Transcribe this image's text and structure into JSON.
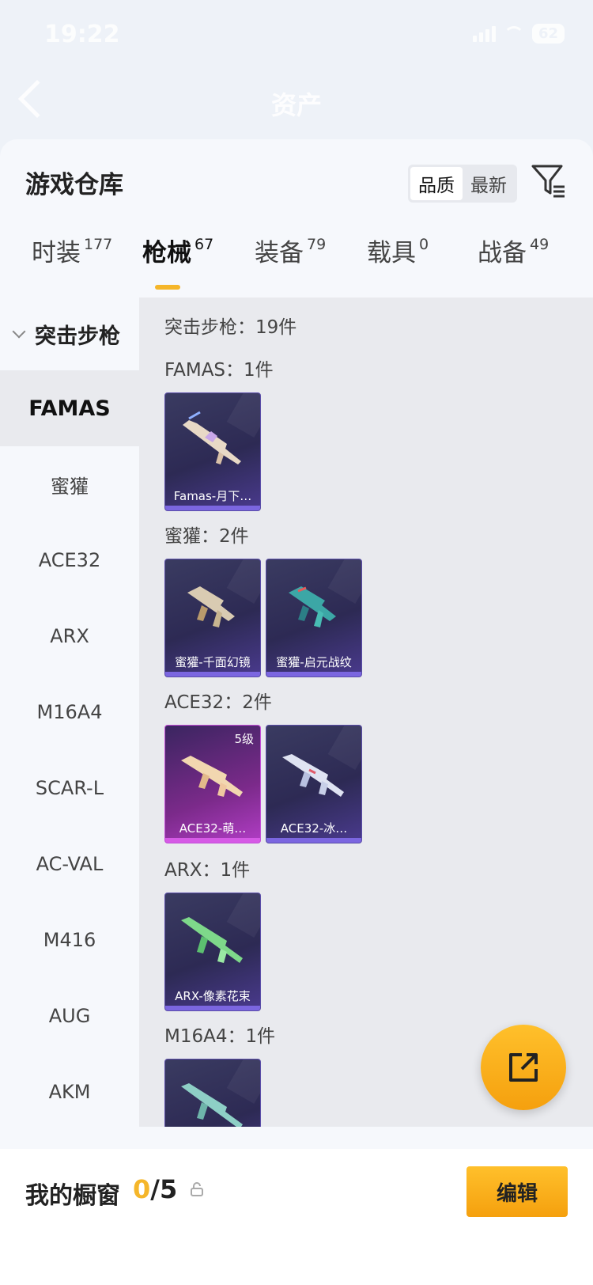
{
  "status": {
    "time": "19:22",
    "battery": "62"
  },
  "nav": {
    "title": "资产"
  },
  "sheet": {
    "title": "游戏仓库",
    "sort": [
      "品质",
      "最新"
    ]
  },
  "tabs": [
    {
      "label": "时装",
      "count": "177"
    },
    {
      "label": "枪械",
      "count": "67"
    },
    {
      "label": "装备",
      "count": "79"
    },
    {
      "label": "载具",
      "count": "0"
    },
    {
      "label": "战备",
      "count": "49"
    }
  ],
  "sidebar": {
    "group": "突击步枪",
    "items": [
      "FAMAS",
      "蜜獾",
      "ACE32",
      "ARX",
      "M16A4",
      "SCAR-L",
      "AC-VAL",
      "M416",
      "AUG",
      "AKM"
    ]
  },
  "content": {
    "header": "突击步枪：19件",
    "sections": [
      {
        "label": "FAMAS：1件",
        "cards": [
          {
            "name": "Famas-月下…"
          }
        ]
      },
      {
        "label": "蜜獾：2件",
        "cards": [
          {
            "name": "蜜獾-千面幻镜"
          },
          {
            "name": "蜜獾-启元战纹"
          }
        ]
      },
      {
        "label": "ACE32：2件",
        "cards": [
          {
            "name": "ACE32-萌…",
            "level": "5级"
          },
          {
            "name": "ACE32-冰…"
          }
        ]
      },
      {
        "label": "ARX：1件",
        "cards": [
          {
            "name": "ARX-像素花束"
          }
        ]
      },
      {
        "label": "M16A4：1件",
        "cards": [
          {
            "name": ""
          }
        ]
      }
    ]
  },
  "showcase": {
    "label": "我的橱窗",
    "current": "0",
    "total": "/5",
    "edit": "编辑"
  },
  "colors": {
    "accent": "#f5b62a",
    "card": "#2d2a54",
    "card_pink": "#b13dc5"
  }
}
